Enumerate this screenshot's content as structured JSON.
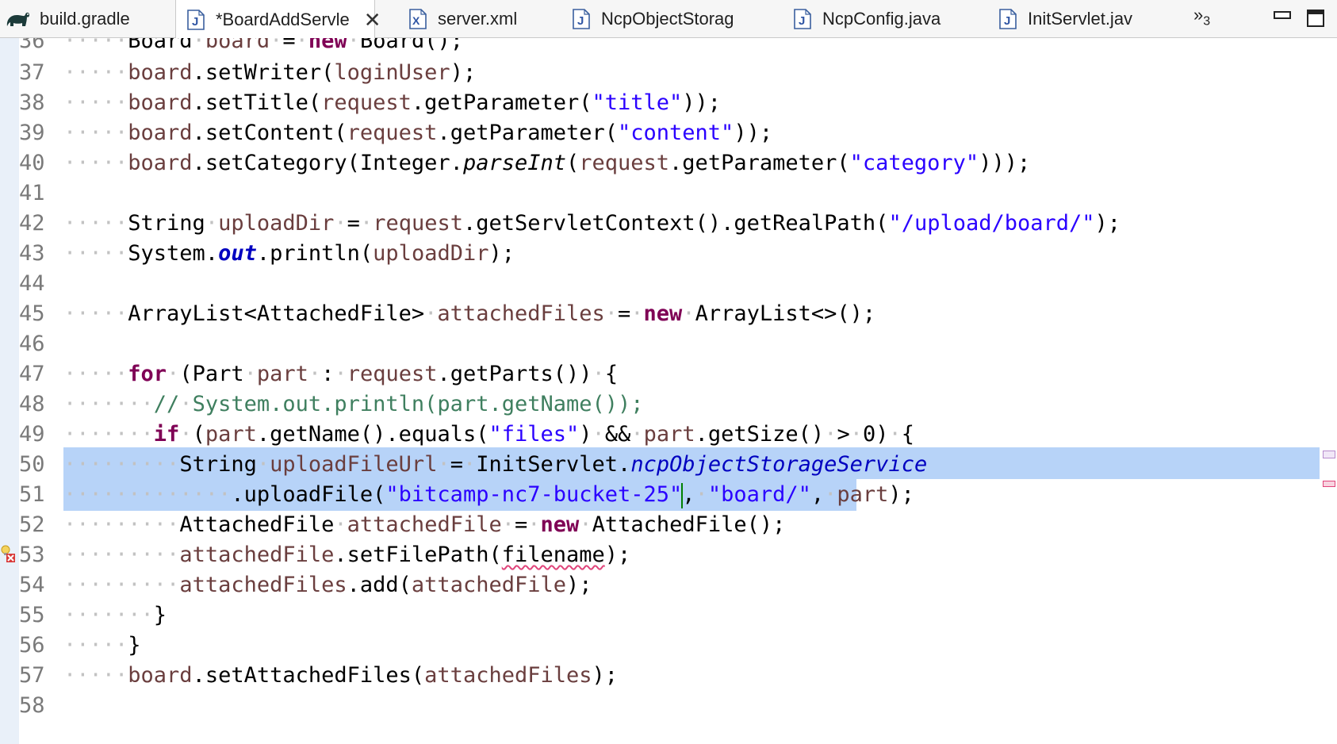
{
  "tabs": [
    {
      "label": "build.gradle",
      "icon": "gradle-elephant-icon",
      "active": false
    },
    {
      "label": "*BoardAddServle",
      "icon": "java-file-icon",
      "active": true,
      "close": "✕"
    },
    {
      "label": "server.xml",
      "icon": "xml-file-icon",
      "active": false
    },
    {
      "label": "NcpObjectStorag",
      "icon": "java-file-icon",
      "active": false
    },
    {
      "label": "NcpConfig.java",
      "icon": "java-file-icon",
      "active": false
    },
    {
      "label": "InitServlet.jav",
      "icon": "java-file-icon",
      "active": false
    }
  ],
  "overflow": {
    "glyph": "»",
    "count": "3"
  },
  "window_controls": [
    "minimize-icon",
    "maximize-icon"
  ],
  "colors": {
    "keyword": "#7f0055",
    "string": "#2a00ff",
    "field": "#0000c0",
    "local_variable": "#6a3e3e",
    "comment": "#3f7f5f",
    "selection": "#b7d3f8",
    "ruler": "#e9f0f9"
  },
  "editor": {
    "lines": [
      {
        "num": "36",
        "text": "Board board = new Board();"
      },
      {
        "num": "37",
        "text": "board.setWriter(loginUser);"
      },
      {
        "num": "38",
        "text": "board.setTitle(request.getParameter(\"title\"));"
      },
      {
        "num": "39",
        "text": "board.setContent(request.getParameter(\"content\"));"
      },
      {
        "num": "40",
        "text": "board.setCategory(Integer.parseInt(request.getParameter(\"category\")));"
      },
      {
        "num": "41",
        "text": ""
      },
      {
        "num": "42",
        "text": "String uploadDir = request.getServletContext().getRealPath(\"/upload/board/\");"
      },
      {
        "num": "43",
        "text": "System.out.println(uploadDir);"
      },
      {
        "num": "44",
        "text": ""
      },
      {
        "num": "45",
        "text": "ArrayList<AttachedFile> attachedFiles = new ArrayList<>();"
      },
      {
        "num": "46",
        "text": ""
      },
      {
        "num": "47",
        "text": "for (Part part : request.getParts()) {"
      },
      {
        "num": "48",
        "text": "// System.out.println(part.getName());"
      },
      {
        "num": "49",
        "text": "if (part.getName().equals(\"files\") && part.getSize() > 0) {"
      },
      {
        "num": "50",
        "text": "String uploadFileUrl = InitServlet.ncpObjectStorageService",
        "selected": true
      },
      {
        "num": "51",
        "text": ".uploadFile(\"bitcamp-nc7-bucket-25\", \"board/\", part);",
        "selected": true
      },
      {
        "num": "52",
        "text": "AttachedFile attachedFile = new AttachedFile();"
      },
      {
        "num": "53",
        "text": "attachedFile.setFilePath(filename);",
        "error": "filename"
      },
      {
        "num": "54",
        "text": "attachedFiles.add(attachedFile);"
      },
      {
        "num": "55",
        "text": "}"
      },
      {
        "num": "56",
        "text": "}"
      },
      {
        "num": "57",
        "text": "board.setAttachedFiles(attachedFiles);"
      },
      {
        "num": "58",
        "text": ""
      }
    ]
  }
}
